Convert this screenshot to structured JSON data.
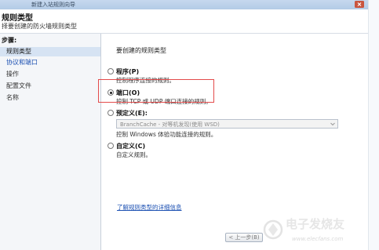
{
  "window": {
    "title": "新建入站规则向导"
  },
  "header": {
    "title": "规则类型",
    "subtitle": "择要创建的防火墙规则类型"
  },
  "steps": {
    "title": "步骤:",
    "items": [
      {
        "label": "规则类型"
      },
      {
        "label": "协议和端口"
      },
      {
        "label": "操作"
      },
      {
        "label": "配置文件"
      },
      {
        "label": "名称"
      }
    ]
  },
  "main": {
    "question": "要创建的规则类型",
    "options": [
      {
        "label": "程序(P)",
        "desc": "控制程序连接的规则。",
        "selected": false
      },
      {
        "label": "端口(O)",
        "desc": "控制 TCP 或 UDP 端口连接的规则。",
        "selected": true
      },
      {
        "label": "预定义(E):",
        "desc": "控制 Windows 体验功能连接的规则。",
        "selected": false
      },
      {
        "label": "自定义(C)",
        "desc": "自定义规则。",
        "selected": false
      }
    ],
    "predefined_value": "BranchCache - 对等机发现(使用 WSD)",
    "learn_more": "了解规则类型的详细信息"
  },
  "footer": {
    "back_label": "< 上一步(B)"
  },
  "watermark": {
    "text": "电子发烧友",
    "url": "www.elecfans.com"
  },
  "colors": {
    "highlight": "#e34b4b",
    "link": "#1e52b3",
    "selected_step": "#d6e3f3"
  }
}
